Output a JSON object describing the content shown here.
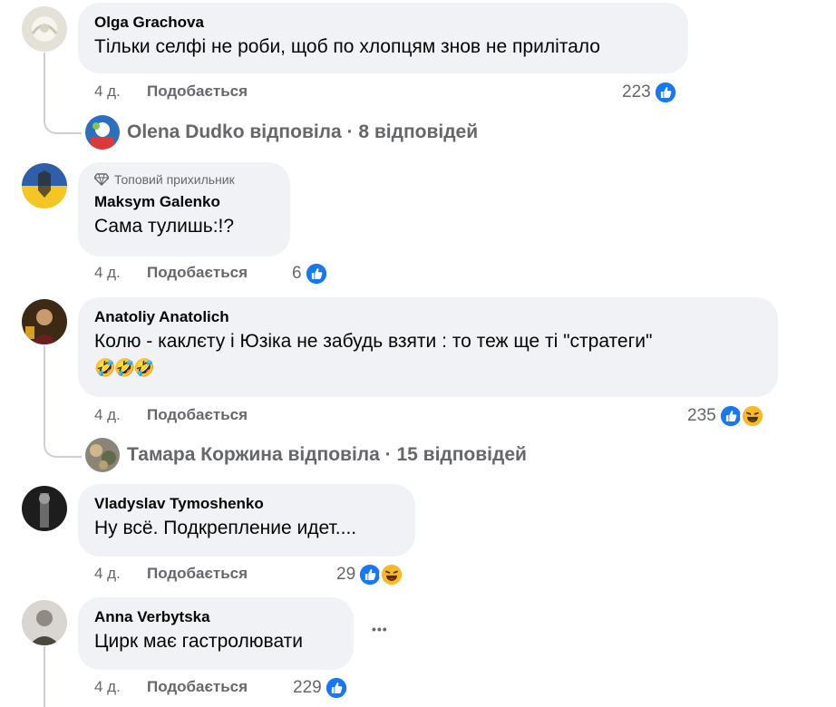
{
  "comments": [
    {
      "author": "Olga Grachova",
      "text": "Тільки селфі не роби, щоб по хлопцям знов не прилітало",
      "time": "4 д.",
      "like_label": "Подобається",
      "reaction_count": "223",
      "reactions": [
        "like-icon"
      ]
    },
    {
      "badge": "Топовий прихильник",
      "author": "Maksym Galenko",
      "text": "Сама тулишь:!?",
      "time": "4 д.",
      "like_label": "Подобається",
      "reaction_count": "6",
      "reactions": [
        "like-icon"
      ]
    },
    {
      "author": "Anatoliy Anatolich",
      "text": "Колю - каклєту і Юзіка не забудь взяти : то теж ще ті \"стратеги\"",
      "emoji": "🤣🤣🤣",
      "time": "4 д.",
      "like_label": "Подобається",
      "reaction_count": "235",
      "reactions": [
        "like-icon",
        "haha-icon"
      ]
    },
    {
      "author": "Vladyslav Tymoshenko",
      "text": "Ну всё. Подкрепление идет....",
      "time": "4 д.",
      "like_label": "Подобається",
      "reaction_count": "29",
      "reactions": [
        "like-icon",
        "haha-icon"
      ]
    },
    {
      "author": "Anna Verbytska",
      "text": "Цирк має гастролювати",
      "time": "4 д.",
      "like_label": "Подобається",
      "reaction_count": "229",
      "reactions": [
        "like-icon"
      ],
      "more_label": "•••"
    }
  ],
  "replies": [
    {
      "text": "Olena Dudko відповіла · 8 відповідей"
    },
    {
      "text": "Тамара Коржина відповіла · 15 відповідей"
    }
  ],
  "colors": {
    "bubble": "#f0f2f5",
    "secondary_text": "#65676b",
    "like_blue": "#1877f2",
    "haha_yellow": "#f7b928"
  }
}
